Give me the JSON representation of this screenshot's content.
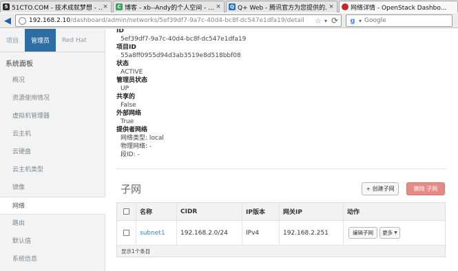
{
  "browser": {
    "tabs": [
      {
        "title": "51CTO.COM - 技术成就梦想 - ...",
        "icon": "51cto-icon",
        "color": "#2b2b2b"
      },
      {
        "title": "博客 - xb--Andy的个人空间 - ...",
        "icon": "blog-icon",
        "color": "#3aa35a"
      },
      {
        "title": "Q+ Web - 腾讯官方为您提供的...",
        "icon": "qplus-icon",
        "color": "#2c6fc4"
      },
      {
        "title": "网络详情 - OpenStack Dashbo...",
        "icon": "openstack-icon",
        "color": "#c62828"
      }
    ],
    "close_glyph": "×",
    "url_host": "192.168.2.10",
    "url_path": "/dashboard/admin/networks/5ef39df7-9a7c-40d4-bc8f-dc547e1dfa19/detail",
    "search_placeholder": "Google"
  },
  "sidebar": {
    "tabs": [
      {
        "label": "项目"
      },
      {
        "label": "管理员"
      },
      {
        "label": "Red Hat"
      }
    ],
    "panel_title": "系统面板",
    "items": [
      {
        "label": "概况"
      },
      {
        "label": "资源使用情况"
      },
      {
        "label": "虚拟机管理器"
      },
      {
        "label": "云主机"
      },
      {
        "label": "云硬盘"
      },
      {
        "label": "云主机类型"
      },
      {
        "label": "镜像"
      },
      {
        "label": "网络"
      },
      {
        "label": "路由"
      },
      {
        "label": "默认值"
      },
      {
        "label": "系统信息"
      }
    ]
  },
  "details": {
    "id_label": "ID",
    "id_value": "5ef39df7-9a7c-40d4-bc8f-dc547e1dfa19",
    "project_label": "项目ID",
    "project_value": "55a8ff0955d94d3ab3519e8d518bbf08",
    "status_label": "状态",
    "status_value": "ACTIVE",
    "admin_state_label": "管理员状态",
    "admin_state_value": "UP",
    "shared_label": "共享的",
    "shared_value": "False",
    "external_label": "外部网络",
    "external_value": "True",
    "provider_label": "提供者网络",
    "provider_type": "网络类型: local",
    "physical_network": "物理网络: -",
    "segment_id": "段ID: -"
  },
  "subnets": {
    "title": "子网",
    "create_label": "+ 创建子网",
    "delete_label": "删除 子网",
    "headers": [
      "名称",
      "CIDR",
      "IP版本",
      "网关IP",
      "动作"
    ],
    "rows": [
      {
        "name": "subnet1",
        "cidr": "192.168.2.0/24",
        "ip_version": "IPv4",
        "gateway": "192.168.2.251",
        "edit_label": "编辑子网",
        "more_label": "更多"
      }
    ],
    "footer": "显示1个条目"
  }
}
